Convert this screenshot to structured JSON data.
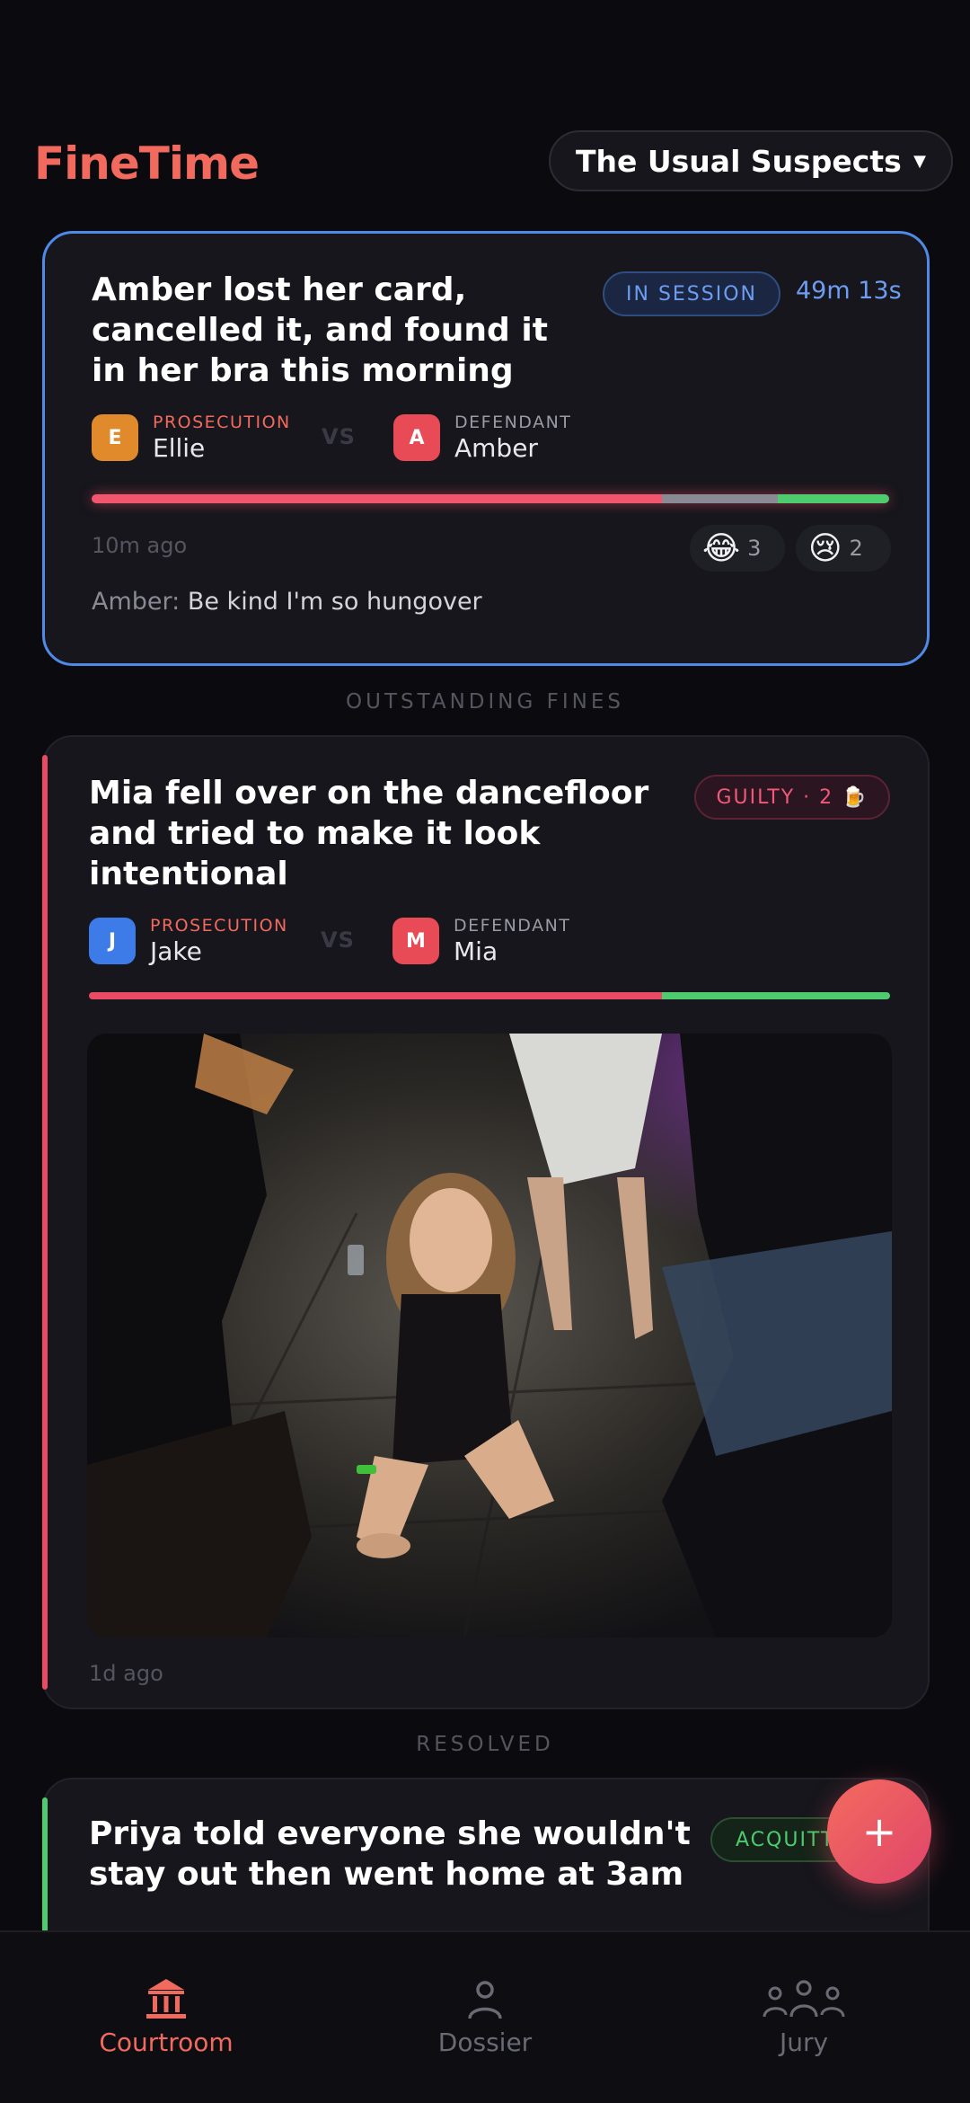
{
  "header": {
    "logo": "FineTime",
    "group_selector": "The Usual Suspects"
  },
  "active_case": {
    "title_lines": [
      "Amber lost her card,",
      "cancelled it, and found it",
      "in her bra this morning"
    ],
    "status": "IN SESSION",
    "timer": "49m 13s",
    "prosecution": {
      "role": "PROSECUTION",
      "name": "Ellie",
      "initial": "E"
    },
    "vs": "VS",
    "defendant": {
      "role": "DEFENDANT",
      "name": "Amber",
      "initial": "A"
    },
    "vote_split": {
      "guilty": 0.715,
      "abstain": 0.145,
      "acquit": 0.14
    },
    "time_ago": "10m ago",
    "reactions": [
      {
        "emoji": "😂",
        "count": "3"
      },
      {
        "emoji": "😢",
        "count": "2"
      }
    ],
    "comment": {
      "author": "Amber:",
      "text": "Be kind I'm so hungover"
    }
  },
  "section_outstanding": "OUTSTANDING FINES",
  "guilty_case": {
    "title_lines": [
      "Mia fell over on the dancefloor",
      "and tried to make it look",
      "intentional"
    ],
    "verdict": "GUILTY · 2 🍺",
    "prosecution": {
      "role": "PROSECUTION",
      "name": "Jake",
      "initial": "J"
    },
    "vs": "VS",
    "defendant": {
      "role": "DEFENDANT",
      "name": "Mia",
      "initial": "M"
    },
    "vote_split": {
      "guilty": 0.715,
      "acquit": 0.285
    },
    "time_ago": "1d ago"
  },
  "section_resolved": "RESOLVED",
  "resolved_case": {
    "title_lines": [
      "Priya told everyone she wouldn't",
      "stay out then went home at 3am"
    ],
    "verdict": "ACQUITTED"
  },
  "fab_label": "+",
  "nav": [
    {
      "label": "Courtroom",
      "icon": "courthouse-icon",
      "active": true
    },
    {
      "label": "Dossier",
      "icon": "person-icon",
      "active": false
    },
    {
      "label": "Jury",
      "icon": "group-icon",
      "active": false
    }
  ],
  "colors": {
    "brand": "#f26a5e",
    "session_blue": "#4f8ae6",
    "guilty_red": "#e84b63",
    "acquit_green": "#4ecb6e"
  }
}
